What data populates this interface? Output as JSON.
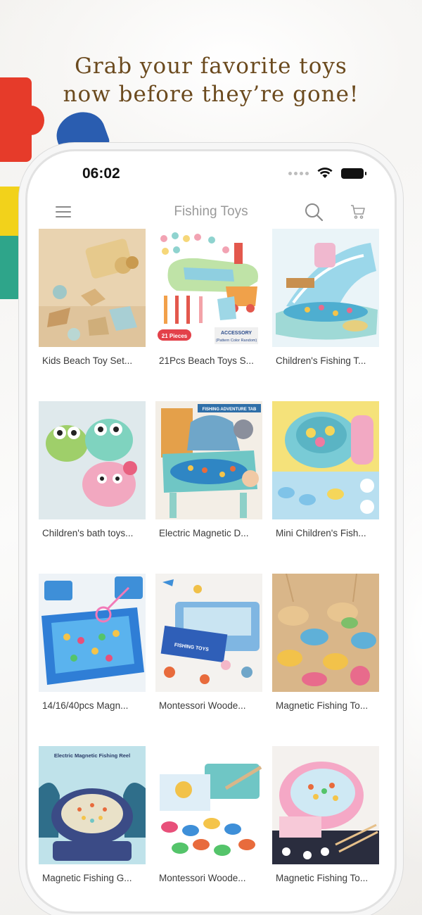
{
  "marketing": {
    "headline_line1": "Grab your favorite toys",
    "headline_line2": "now before they’re gone!"
  },
  "status_bar": {
    "time": "06:02",
    "icons": [
      "signal-dots-icon",
      "wifi-icon",
      "battery-icon"
    ]
  },
  "header": {
    "title": "Fishing Toys",
    "icons": [
      "hamburger-menu-icon",
      "search-icon",
      "cart-icon"
    ]
  },
  "products": [
    {
      "title": "Kids Beach Toy Set...",
      "image": "beach-toy-set"
    },
    {
      "title": "21Pcs Beach Toys S...",
      "image": "beach-toys-21pcs",
      "badge": "21 Pieces",
      "caption_line1": "ACCESSORY",
      "caption_line2": "(Pattern Color Random)"
    },
    {
      "title": "Children's Fishing T...",
      "image": "fishing-track-toy"
    },
    {
      "title": "Children's bath toys...",
      "image": "bath-toys-frogs"
    },
    {
      "title": "Electric Magnetic D...",
      "image": "electric-fishing-table",
      "banner": "FISHING ADVENTURE TAB"
    },
    {
      "title": "Mini Children's Fish...",
      "image": "mini-fishing-game"
    },
    {
      "title": "14/16/40pcs Magn...",
      "image": "inflatable-pool-fishing"
    },
    {
      "title": "Montessori Woode...",
      "image": "wooden-fishing-tin",
      "box_label": "FISHING TOYS"
    },
    {
      "title": "Magnetic Fishing To...",
      "image": "wooden-sea-animals"
    },
    {
      "title": "Magnetic Fishing G...",
      "image": "electric-fishing-reel",
      "banner": "Electric Magnetic Fishing Reel"
    },
    {
      "title": "Montessori Woode...",
      "image": "wooden-fishing-box"
    },
    {
      "title": "Magnetic Fishing To...",
      "image": "pink-fishing-game"
    }
  ],
  "colors": {
    "headline": "#6b4a1e",
    "header_title": "#9a9a9a",
    "card_title": "#3a3a3a"
  }
}
